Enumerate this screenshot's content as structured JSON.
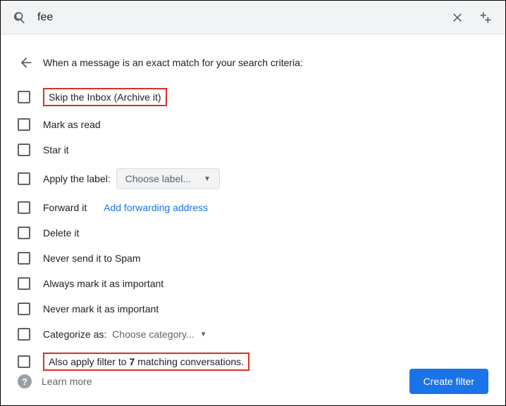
{
  "search": {
    "query": "fee"
  },
  "header": {
    "text": "When a message is an exact match for your search criteria:"
  },
  "options": {
    "skip_inbox": "Skip the Inbox (Archive it)",
    "mark_read": "Mark as read",
    "star": "Star it",
    "apply_label_text": "Apply the label:",
    "choose_label": "Choose label...",
    "forward": "Forward it",
    "add_forwarding": "Add forwarding address",
    "delete": "Delete it",
    "never_spam": "Never send it to Spam",
    "always_important": "Always mark it as important",
    "never_important": "Never mark it as important",
    "categorize_text": "Categorize as:",
    "choose_category": "Choose category...",
    "also_apply_pre": "Also apply filter to ",
    "also_apply_count": "7",
    "also_apply_post": " matching conversations."
  },
  "footer": {
    "learn_more": "Learn more",
    "create": "Create filter"
  }
}
